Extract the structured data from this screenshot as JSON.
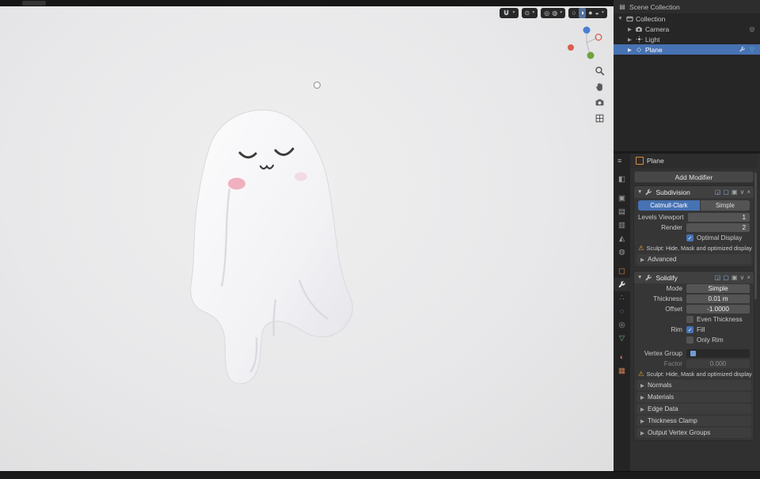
{
  "colors": {
    "accent": "#4772b3",
    "warning": "#dda33c",
    "object_orange": "#dd8a3c",
    "mesh_teal": "#5fc2ad"
  },
  "viewport": {
    "shading": {
      "modes": [
        "wireframe",
        "solid",
        "material-preview",
        "rendered"
      ],
      "active": "solid"
    },
    "tools": [
      "zoom",
      "pan",
      "camera-view",
      "toggle-grid"
    ]
  },
  "outliner": {
    "header": "Scene Collection",
    "items": [
      {
        "label": "Collection"
      },
      {
        "label": "Camera"
      },
      {
        "label": "Light"
      },
      {
        "label": "Plane",
        "selected": true
      }
    ]
  },
  "properties": {
    "breadcrumb_object": "Plane",
    "add_modifier_label": "Add Modifier",
    "subdivision": {
      "name": "Subdivision",
      "type_catmull": "Catmull-Clark",
      "type_simple": "Simple",
      "levels_viewport_label": "Levels Viewport",
      "levels_viewport_value": "1",
      "render_label": "Render",
      "render_value": "2",
      "optimal_display_label": "Optimal Display",
      "warning_text": "Sculpt: Hide, Mask and optimized display disab",
      "advanced_label": "Advanced"
    },
    "solidify": {
      "name": "Solidify",
      "mode_label": "Mode",
      "mode_value": "Simple",
      "thickness_label": "Thickness",
      "thickness_value": "0.01 m",
      "offset_label": "Offset",
      "offset_value": "-1.0000",
      "even_thickness_label": "Even Thickness",
      "rim_label": "Rim",
      "fill_label": "Fill",
      "only_rim_label": "Only Rim",
      "vertex_group_label": "Vertex Group",
      "factor_label": "Factor",
      "factor_value": "0.000",
      "warning_text": "Sculpt: Hide, Mask and optimized display disab",
      "sections": [
        "Normals",
        "Materials",
        "Edge Data",
        "Thickness Clamp",
        "Output Vertex Groups"
      ]
    }
  }
}
